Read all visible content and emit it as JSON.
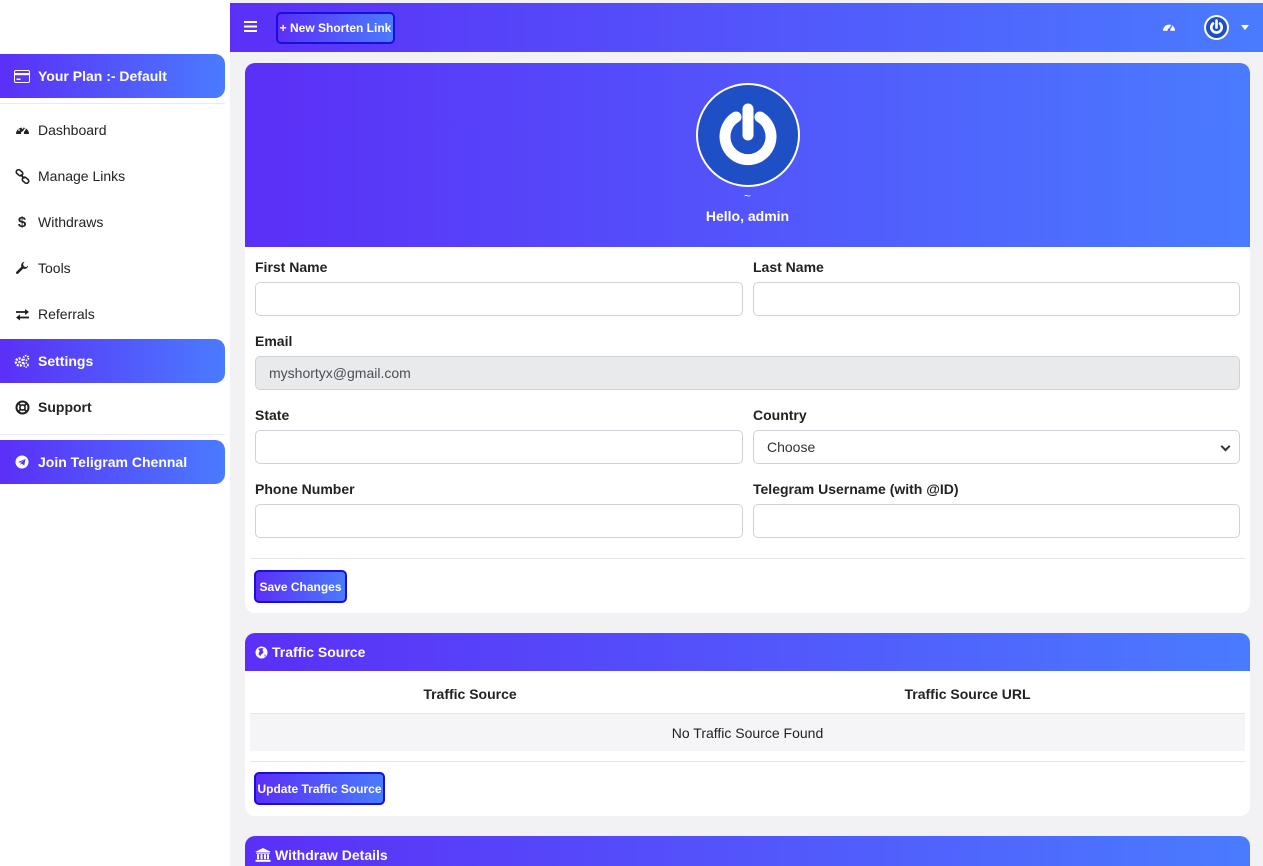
{
  "sidebar": {
    "plan_label": "Your Plan :- Default",
    "items": [
      {
        "label": "Dashboard",
        "icon": "tachometer-icon"
      },
      {
        "label": "Manage Links",
        "icon": "link-icon"
      },
      {
        "label": "Withdraws",
        "icon": "dollar-icon"
      },
      {
        "label": "Tools",
        "icon": "wrench-icon"
      },
      {
        "label": "Referrals",
        "icon": "exchange-icon"
      },
      {
        "label": "Settings",
        "icon": "gears-icon"
      },
      {
        "label": "Support",
        "icon": "lifebuoy-icon"
      }
    ],
    "telegram_label": "Join Teligram Chennal"
  },
  "topbar": {
    "new_link_label": "+ New Shorten Link"
  },
  "profile": {
    "tilde": "~",
    "greeting": "Hello, admin",
    "first_name_label": "First Name",
    "first_name_value": "",
    "last_name_label": "Last Name",
    "last_name_value": "",
    "email_label": "Email",
    "email_value": "myshortyx@gmail.com",
    "state_label": "State",
    "state_value": "",
    "country_label": "Country",
    "country_value": "Choose",
    "phone_label": "Phone Number",
    "phone_value": "",
    "telegram_label": "Telegram Username (with @ID)",
    "telegram_value": "",
    "save_label": "Save Changes"
  },
  "traffic": {
    "title": "Traffic Source",
    "col_source": "Traffic Source",
    "col_url": "Traffic Source URL",
    "empty_text": "No Traffic Source Found",
    "update_label": "Update Traffic Source"
  },
  "withdraw": {
    "title": "Withdraw Details"
  },
  "colors": {
    "gradient_start": "#5b2ff7",
    "gradient_end": "#4a7bff",
    "button_border": "#1a0fd6",
    "avatar_blue": "#1f4fc4"
  }
}
